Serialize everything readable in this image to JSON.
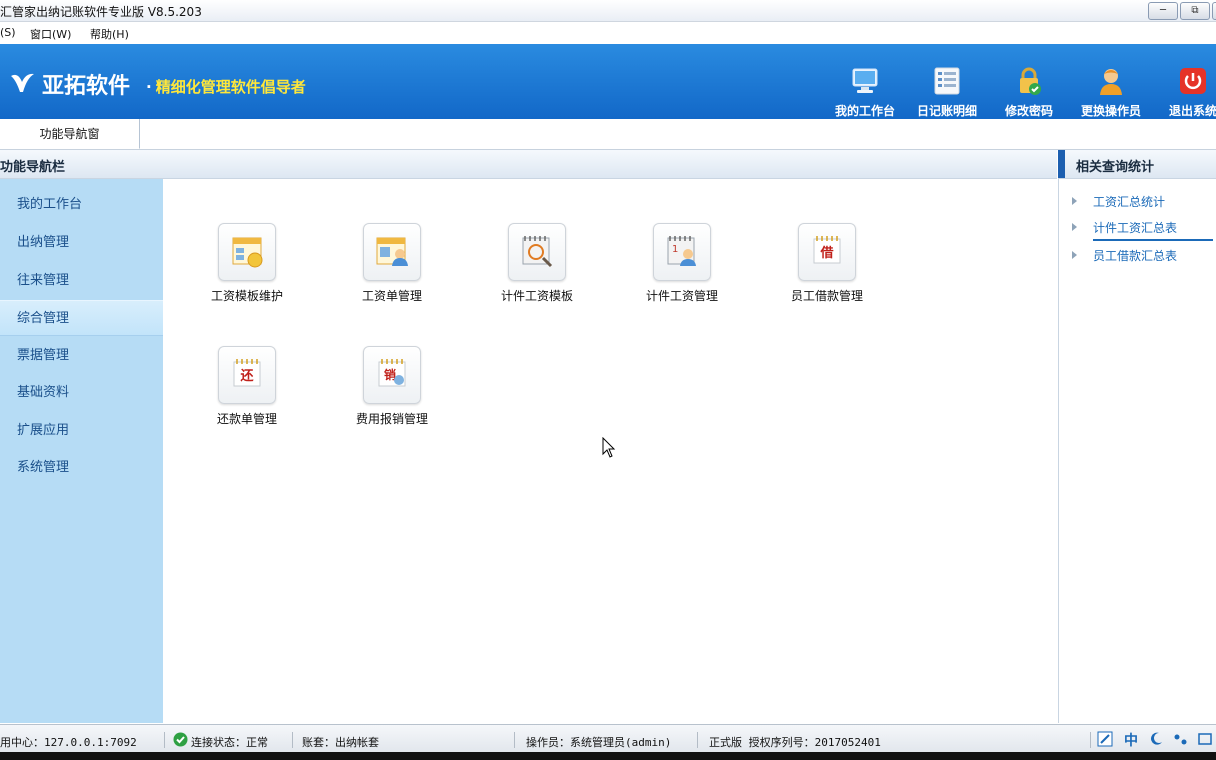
{
  "window": {
    "title": "汇管家出纳记账软件专业版 V8.5.203"
  },
  "menu": [
    "(S)",
    "窗口(W)",
    "帮助(H)"
  ],
  "banner": {
    "brand": "亚拓软件",
    "dot": "·",
    "slogan": "精细化管理软件倡导者",
    "tools": [
      {
        "label": "我的工作台",
        "icon": "monitor-icon"
      },
      {
        "label": "日记账明细",
        "icon": "ledger-list-icon"
      },
      {
        "label": "修改密码",
        "icon": "lock-icon"
      },
      {
        "label": "更换操作员",
        "icon": "user-icon"
      },
      {
        "label": "退出系统",
        "icon": "power-icon"
      }
    ]
  },
  "tabs": {
    "main": "功能导航窗"
  },
  "nav": {
    "header": "功能导航栏",
    "items": [
      "我的工作台",
      "出纳管理",
      "往来管理",
      "综合管理",
      "票据管理",
      "基础资料",
      "扩展应用",
      "系统管理"
    ],
    "active_index": 3
  },
  "modules": [
    {
      "label": "工资模板维护",
      "icon": "salary-template-icon"
    },
    {
      "label": "工资单管理",
      "icon": "payslip-icon"
    },
    {
      "label": "计件工资模板",
      "icon": "piece-wage-template-icon"
    },
    {
      "label": "计件工资管理",
      "icon": "piece-wage-icon"
    },
    {
      "label": "员工借款管理",
      "icon": "loan-icon",
      "glyph": "借"
    },
    {
      "label": "还款单管理",
      "icon": "repayment-icon",
      "glyph": "还"
    },
    {
      "label": "费用报销管理",
      "icon": "reimburse-icon",
      "glyph": "销"
    }
  ],
  "right_panel": {
    "header": "相关查询统计",
    "links": [
      "工资汇总统计",
      "计件工资汇总表",
      "员工借款汇总表"
    ]
  },
  "status": {
    "center": "用中心：127.0.0.1:7092",
    "connection": "连接状态：正常",
    "account": "账套：出纳帐套",
    "operator": "操作员：系统管理员(admin)",
    "license": "正式版 授权序列号：2017052401",
    "ime": "中"
  },
  "colors": {
    "banner": "#1a76d2",
    "slogan": "#ffe73a",
    "sidebar": "#b6dcf5",
    "link": "#1b6ab8"
  }
}
